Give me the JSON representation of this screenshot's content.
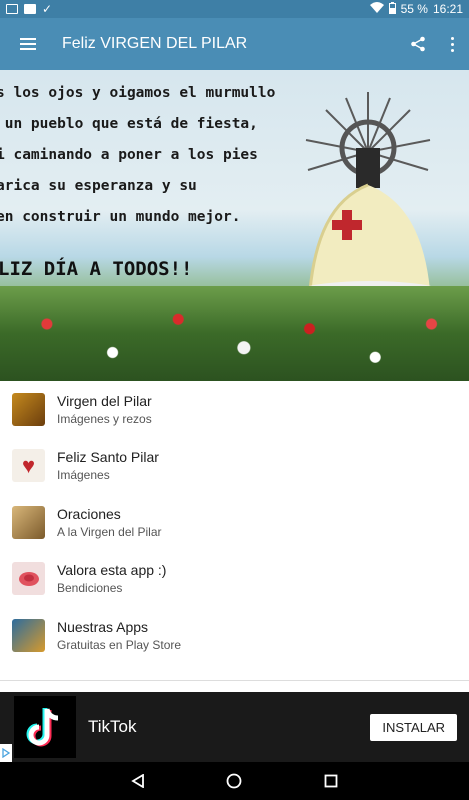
{
  "status_bar": {
    "battery": "55 %",
    "time": "16:21"
  },
  "toolbar": {
    "title": "Feliz VIRGEN DEL PILAR",
    "icons": [
      "menu-icon",
      "share-icon",
      "more-vert-icon"
    ]
  },
  "banner": {
    "lines": [
      "s los ojos y oigamos el murmullo",
      " un pueblo que está de fiesta,",
      "i caminando a poner a los pies",
      "arica su esperanza y su",
      "en construir un mundo mejor."
    ],
    "greeting": "LIZ DÍA A TODOS!!"
  },
  "list": {
    "items": [
      {
        "title": "Virgen del Pilar",
        "subtitle": "Imágenes y rezos",
        "icon": "virgin-thumb-icon"
      },
      {
        "title": "Feliz Santo Pilar",
        "subtitle": "Imágenes",
        "icon": "heart-thumb-icon"
      },
      {
        "title": "Oraciones",
        "subtitle": "A la Virgen del Pilar",
        "icon": "prayer-thumb-icon"
      },
      {
        "title": "Valora esta app :)",
        "subtitle": "Bendiciones",
        "icon": "rose-thumb-icon"
      },
      {
        "title": "Nuestras Apps",
        "subtitle": "Gratuitas en Play Store",
        "icon": "apps-thumb-icon"
      }
    ]
  },
  "ad": {
    "app_name": "TikTok",
    "button_label": "INSTALAR"
  },
  "colors": {
    "toolbar": "#4a8db5",
    "status_bar": "#3e7fa6",
    "ad_background": "#1a1a1a"
  }
}
